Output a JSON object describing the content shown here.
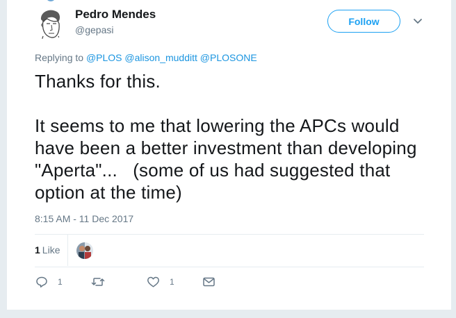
{
  "user": {
    "name": "Pedro Mendes",
    "handle": "@gepasi"
  },
  "follow_label": "Follow",
  "replying": {
    "prefix": "Replying to",
    "mentions": [
      "@PLOS",
      "@alison_mudditt",
      "@PLOSONE"
    ]
  },
  "tweet": {
    "line1": "Thanks for this.",
    "line2": "It seems to me that lowering the APCs would have been a better investment than developing \"Aperta\"...   (some of us had suggested that option at the time)"
  },
  "timestamp": "8:15 AM - 11 Dec 2017",
  "stats": {
    "likes_count": "1",
    "likes_label": "Like"
  },
  "actions": {
    "reply_count": "1",
    "like_count": "1"
  },
  "colors": {
    "accent": "#1da1f2",
    "text": "#14171a",
    "muted": "#657786"
  }
}
